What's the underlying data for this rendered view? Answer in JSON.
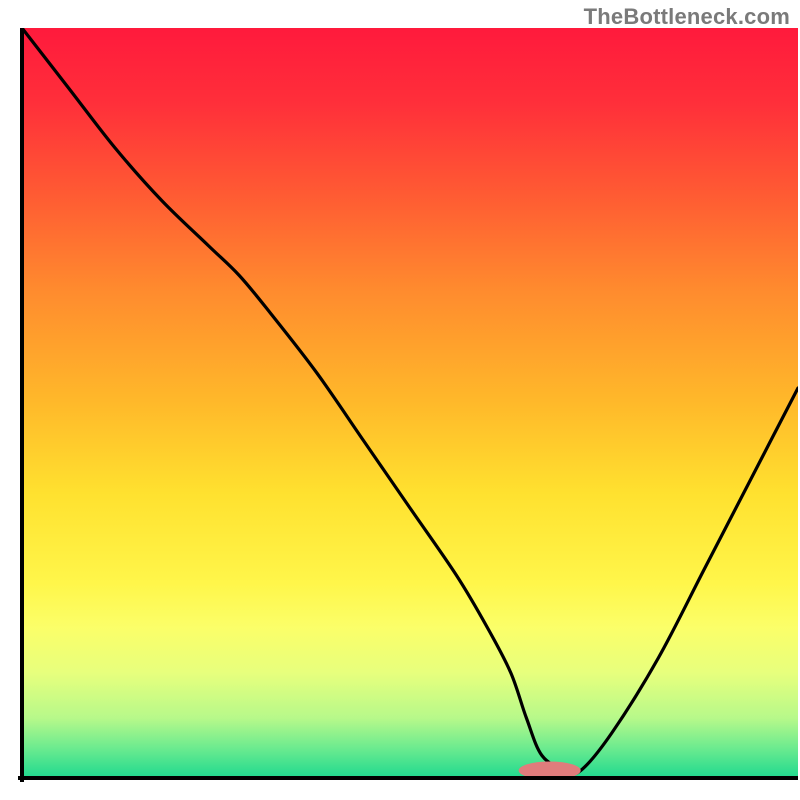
{
  "watermark": "TheBottleneck.com",
  "chart_data": {
    "type": "line",
    "title": "",
    "xlabel": "",
    "ylabel": "",
    "xlim": [
      0,
      100
    ],
    "ylim": [
      0,
      100
    ],
    "grid": false,
    "legend": false,
    "annotations": [],
    "background": {
      "type": "vertical-gradient",
      "stops": [
        {
          "pos": 0.0,
          "color": "#ff1a3c"
        },
        {
          "pos": 0.1,
          "color": "#ff2f3a"
        },
        {
          "pos": 0.22,
          "color": "#ff5a33"
        },
        {
          "pos": 0.35,
          "color": "#ff8b2e"
        },
        {
          "pos": 0.5,
          "color": "#ffb92a"
        },
        {
          "pos": 0.62,
          "color": "#ffe12f"
        },
        {
          "pos": 0.74,
          "color": "#fff64a"
        },
        {
          "pos": 0.8,
          "color": "#fbff69"
        },
        {
          "pos": 0.86,
          "color": "#e7ff7d"
        },
        {
          "pos": 0.92,
          "color": "#b7f98a"
        },
        {
          "pos": 0.96,
          "color": "#6ceb8f"
        },
        {
          "pos": 1.0,
          "color": "#1fd98f"
        }
      ]
    },
    "series": [
      {
        "name": "curve",
        "color": "#000000",
        "x": [
          0,
          6,
          12,
          18,
          24,
          28,
          32,
          38,
          44,
          50,
          56,
          60,
          63,
          65,
          67,
          70,
          72,
          76,
          82,
          88,
          94,
          100
        ],
        "y": [
          100,
          92,
          84,
          77,
          71,
          67,
          62,
          54,
          45,
          36,
          27,
          20,
          14,
          8,
          3,
          1,
          1,
          6,
          16,
          28,
          40,
          52
        ]
      }
    ],
    "marker": {
      "name": "bottleneck-marker",
      "color": "#e07c7c",
      "x_center": 68,
      "y_center": 1,
      "rx": 4,
      "ry": 1.2
    },
    "axes": {
      "x0": 2.5,
      "y0": 97.2,
      "stroke": "#000000",
      "width": 4
    }
  }
}
